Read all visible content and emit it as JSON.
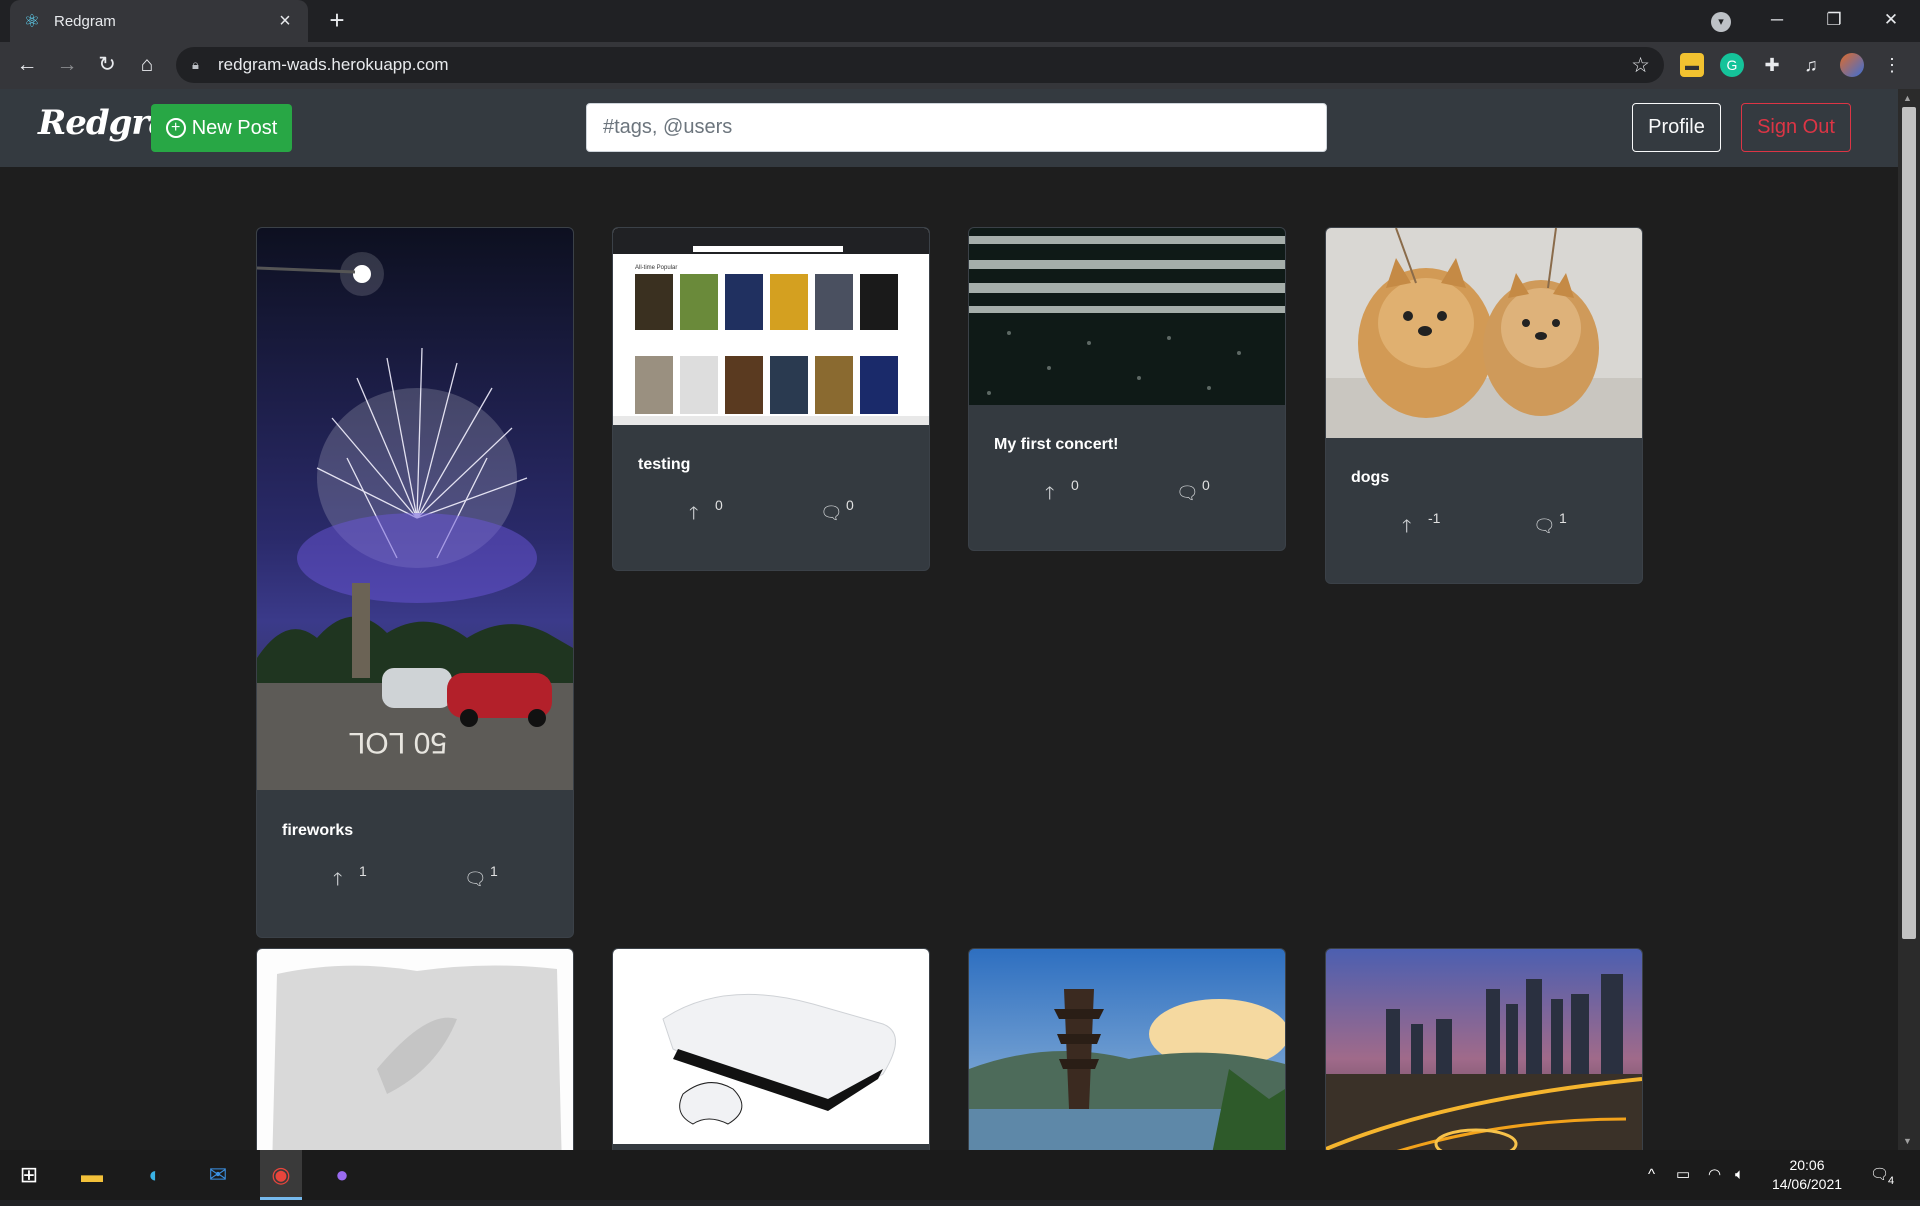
{
  "browser": {
    "tab_title": "Redgram",
    "url": "redgram-wads.herokuapp.com",
    "icons": [
      "react-favicon-icon",
      "close-tab-icon",
      "new-tab-icon",
      "back-icon",
      "forward-icon",
      "reload-icon",
      "home-icon",
      "lock-icon",
      "bookmark-star-icon",
      "extension-icons",
      "profile-avatar-icon",
      "menu-icon"
    ]
  },
  "app": {
    "brand": "Redgram",
    "new_post_label": "New Post",
    "search_placeholder": "#tags, @users",
    "profile_label": "Profile",
    "signout_label": "Sign Out"
  },
  "posts": [
    {
      "title": "fireworks",
      "upvotes": "1",
      "comments": "1"
    },
    {
      "title": "testing",
      "upvotes": "0",
      "comments": "0"
    },
    {
      "title": "My first concert!",
      "upvotes": "0",
      "comments": "0"
    },
    {
      "title": "dogs",
      "upvotes": "-1",
      "comments": "1"
    }
  ],
  "taskbar": {
    "time": "20:06",
    "date": "14/06/2021",
    "notification_count": "4"
  }
}
